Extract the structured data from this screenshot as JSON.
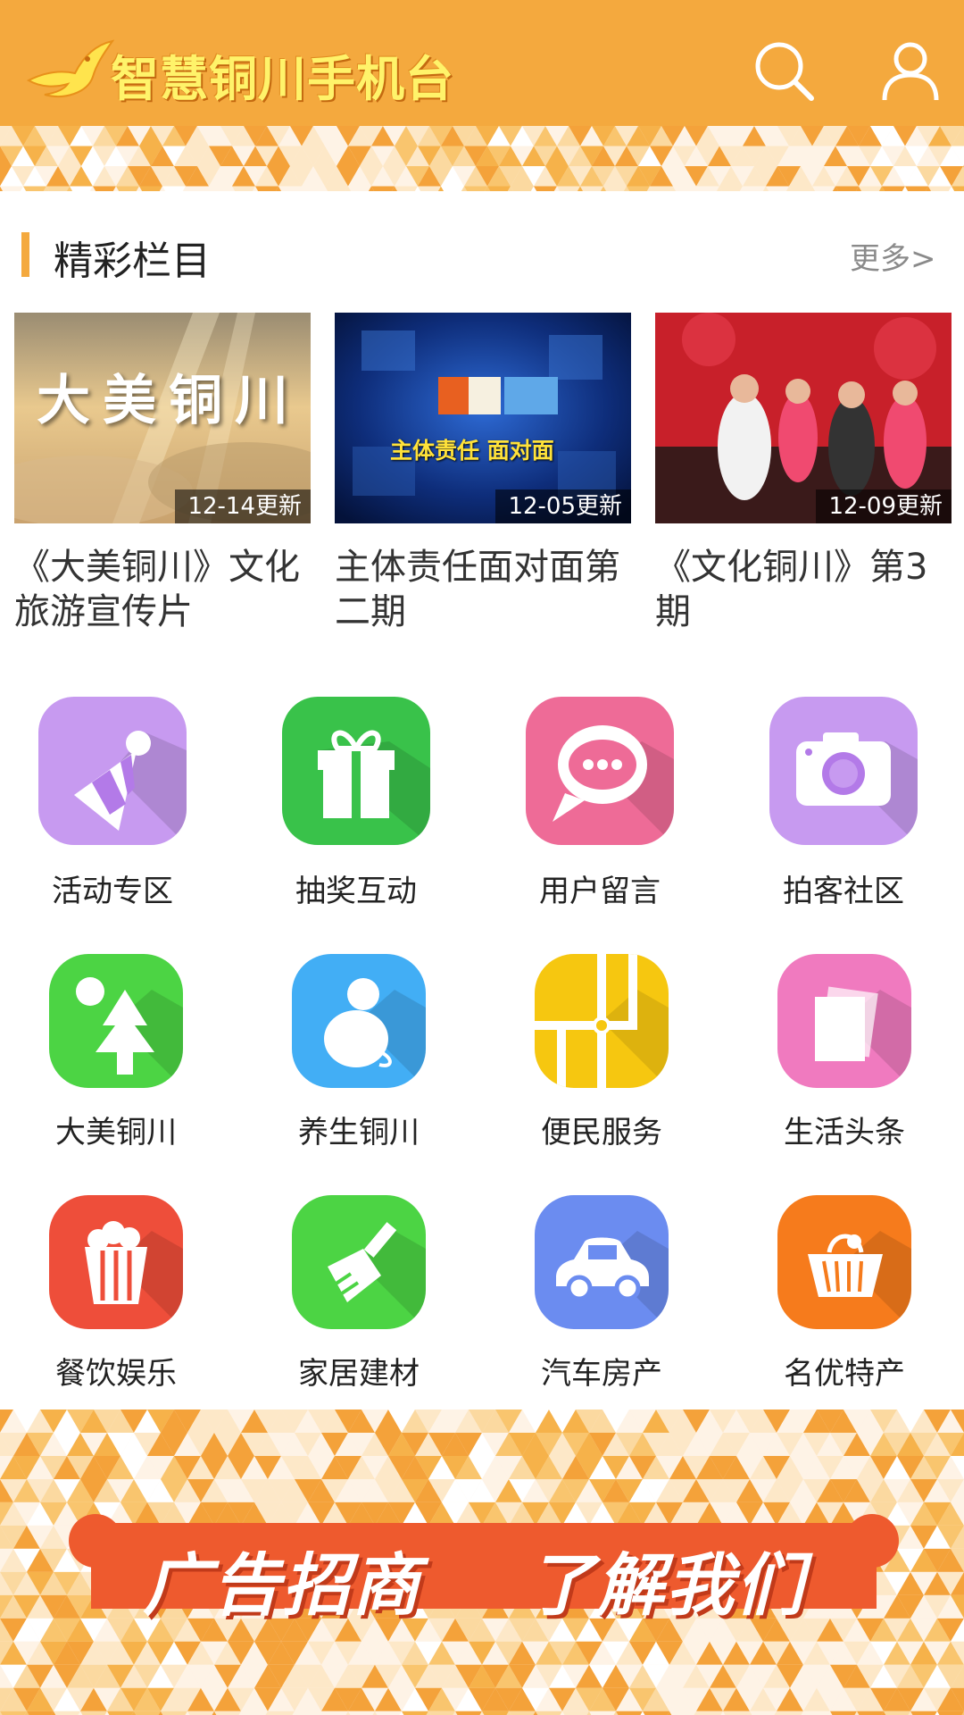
{
  "header": {
    "app_title": "智慧铜川手机台",
    "background_color": "#F4A93E",
    "icons": [
      "search-icon",
      "user-icon"
    ]
  },
  "section": {
    "title": "精彩栏目",
    "more_label": "更多>"
  },
  "programs": [
    {
      "title": "《大美铜川》文化旅游宣传片",
      "badge": "12-14更新",
      "thumb_text": "大美铜川"
    },
    {
      "title": "主体责任面对面第二期",
      "badge": "12-05更新",
      "thumb_text": "主体责任 面对面"
    },
    {
      "title": "《文化铜川》第3期",
      "badge": "12-09更新"
    }
  ],
  "grid": [
    {
      "label": "活动专区",
      "icon": "party-hat-icon",
      "color": "#C79AF0"
    },
    {
      "label": "抽奖互动",
      "icon": "gift-icon",
      "color": "#39C24A"
    },
    {
      "label": "用户留言",
      "icon": "chat-bubble-icon",
      "color": "#EE6B97"
    },
    {
      "label": "拍客社区",
      "icon": "camera-icon",
      "color": "#C79AF0"
    },
    {
      "label": "大美铜川",
      "icon": "tree-icon",
      "color": "#4CD444"
    },
    {
      "label": "养生铜川",
      "icon": "gourd-icon",
      "color": "#42AEF5"
    },
    {
      "label": "便民服务",
      "icon": "map-icon",
      "color": "#F6C710"
    },
    {
      "label": "生活头条",
      "icon": "news-pages-icon",
      "color": "#F07ABF"
    },
    {
      "label": "餐饮娱乐",
      "icon": "popcorn-icon",
      "color": "#EE4E3A"
    },
    {
      "label": "家居建材",
      "icon": "brush-icon",
      "color": "#4CD444"
    },
    {
      "label": "汽车房产",
      "icon": "car-icon",
      "color": "#6B8CF0"
    },
    {
      "label": "名优特产",
      "icon": "basket-icon",
      "color": "#F67B1C"
    }
  ],
  "ad": {
    "left_text": "广告招商",
    "right_text": "了解我们",
    "banner_color": "#EE5A2E"
  }
}
